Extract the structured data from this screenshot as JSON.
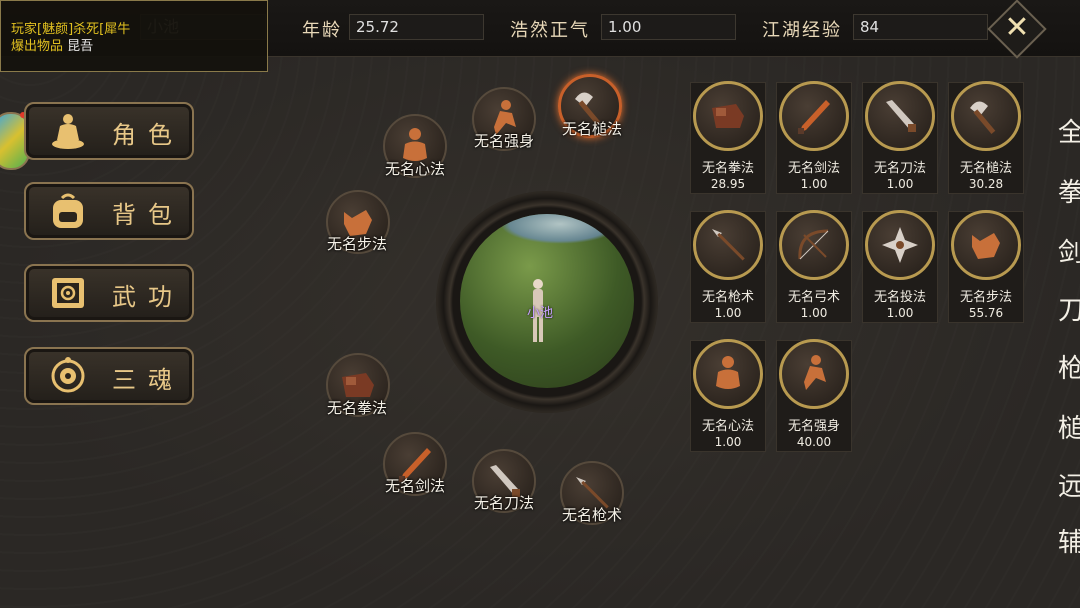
{
  "kill_notice": {
    "line1": "玩家[魅颜]杀死[犀牛",
    "line2_prefix": "爆出物品",
    "line2_item": "昆吾"
  },
  "player_name": "小池",
  "stats": {
    "age_label": "年龄",
    "age_value": "25.72",
    "righteous_label": "浩然正气",
    "righteous_value": "1.00",
    "exp_label": "江湖经验",
    "exp_value": "84"
  },
  "close_icon": "close-icon",
  "menu": [
    {
      "label": "角色",
      "icon": "meditate-figure-icon"
    },
    {
      "label": "背包",
      "icon": "backpack-icon"
    },
    {
      "label": "武功",
      "icon": "scroll-icon"
    },
    {
      "label": "三魂",
      "icon": "soul-emblem-icon"
    }
  ],
  "orbit_skills": [
    {
      "label": "无名心法",
      "icon": "meditate-icon"
    },
    {
      "label": "无名强身",
      "icon": "runner-icon"
    },
    {
      "label": "无名槌法",
      "icon": "axe-icon",
      "selected": true
    },
    {
      "label": "无名步法",
      "icon": "fox-icon"
    },
    {
      "label": "无名拳法",
      "icon": "gauntlet-icon"
    },
    {
      "label": "无名剑法",
      "icon": "sword-icon"
    },
    {
      "label": "无名刀法",
      "icon": "blade-icon"
    },
    {
      "label": "无名枪术",
      "icon": "spear-icon"
    }
  ],
  "portrait": {
    "character_name": "小池"
  },
  "skill_grid": [
    {
      "name": "无名拳法",
      "value": "28.95",
      "icon": "gauntlet-icon"
    },
    {
      "name": "无名剑法",
      "value": "1.00",
      "icon": "sword-icon"
    },
    {
      "name": "无名刀法",
      "value": "1.00",
      "icon": "blade-icon"
    },
    {
      "name": "无名槌法",
      "value": "30.28",
      "icon": "axe-icon"
    },
    {
      "name": "无名枪术",
      "value": "1.00",
      "icon": "spear-icon"
    },
    {
      "name": "无名弓术",
      "value": "1.00",
      "icon": "bow-icon"
    },
    {
      "name": "无名投法",
      "value": "1.00",
      "icon": "shuriken-icon"
    },
    {
      "name": "无名步法",
      "value": "55.76",
      "icon": "fox-icon"
    },
    {
      "name": "无名心法",
      "value": "1.00",
      "icon": "meditate-icon"
    },
    {
      "name": "无名强身",
      "value": "40.00",
      "icon": "runner-icon"
    }
  ],
  "categories": [
    "全",
    "拳",
    "剑",
    "刀",
    "枪",
    "槌",
    "远",
    "辅"
  ],
  "colors": {
    "accent_gold": "#b89a50",
    "selected_ring": "#c8602a",
    "kill_text": "#e0c020"
  }
}
